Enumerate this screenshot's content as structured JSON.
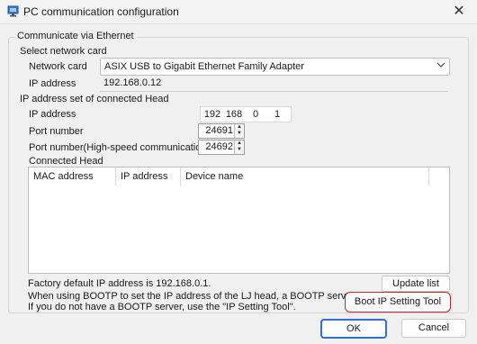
{
  "window": {
    "title": "PC communication configuration",
    "close_glyph": "✕"
  },
  "group": {
    "title": "Communicate via Ethernet",
    "network_section": "Select network card",
    "network_card_label": "Network card",
    "network_card_value": "ASIX USB to Gigabit Ethernet Family Adapter",
    "ip_address_label": "IP address",
    "ip_address_value": "192.168.0.12"
  },
  "head": {
    "section": "IP address set of connected Head",
    "ip_label": "IP address",
    "ip_octets": [
      "192",
      "168",
      "0",
      "1"
    ],
    "port_label": "Port number",
    "port_value": "24691",
    "hs_port_label": "Port number(High-speed communication)",
    "hs_port_value": "24692",
    "connected_label": "Connected Head",
    "columns": [
      "MAC address",
      "IP address",
      "Device name"
    ]
  },
  "footer": {
    "factory_default": "Factory default IP address is 192.168.0.1.",
    "update_button": "Update list",
    "bootp_line1": "When using BOOTP to set the IP address of the LJ head, a BOOTP server is required.",
    "bootp_line2": "If you do not have a BOOTP server, use the \"IP Setting Tool\".",
    "boot_tool_button": "Boot IP Setting Tool",
    "ok_button": "OK",
    "cancel_button": "Cancel"
  },
  "icons": {
    "dropdown": "chevron-down-icon",
    "spin_up": "caret-up-icon",
    "spin_down": "caret-down-icon",
    "app": "pc-network-icon"
  },
  "colors": {
    "highlight": "#c8262c",
    "ok_border": "#2f6fd1"
  }
}
